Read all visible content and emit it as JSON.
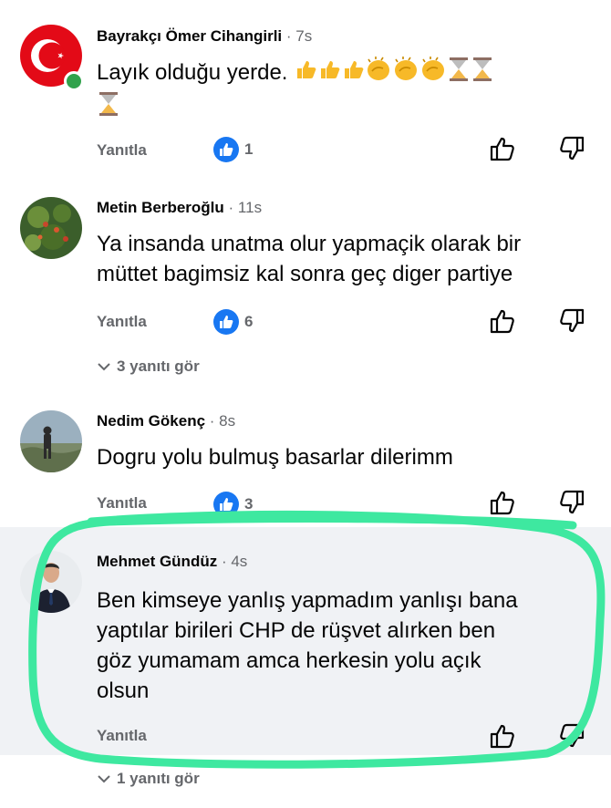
{
  "comments": [
    {
      "name": "Bayrakçı Ömer Cihangirli",
      "time": "· 7s",
      "text": "Layık olduğu yerde.",
      "reply_label": "Yanıtla",
      "likes": "1"
    },
    {
      "name": "Metin Berberoğlu",
      "time": "· 11s",
      "text_line1": "Ya insanda unatma olur yapmaçik olarak bir",
      "text_line2": "müttet bagimsiz kal sonra geç diger partiye",
      "reply_label": "Yanıtla",
      "likes": "6",
      "replies_link": "3 yanıtı gör"
    },
    {
      "name": "Nedim Gökenç",
      "time": "· 8s",
      "text": "Dogru yolu bulmuş basarlar dilerimm",
      "reply_label": "Yanıtla",
      "likes": "3"
    },
    {
      "name": "Mehmet Gündüz",
      "time": "· 4s",
      "text_line1": "Ben kimseye yanlış yapmadım yanlışı bana",
      "text_line2": "yaptılar birileri CHP de rüşvet alırken ben",
      "text_line3": "göz yumamam amca herkesin yolu açık",
      "text_line4": "olsun",
      "reply_label": "Yanıtla",
      "replies_link": "1 yanıtı gör"
    }
  ],
  "colors": {
    "like_blue": "#1877f2",
    "highlight_green": "#3ee8a0",
    "highlight_bg": "#f0f2f5"
  }
}
